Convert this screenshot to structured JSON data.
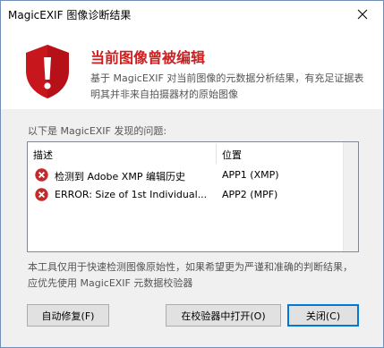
{
  "window": {
    "title": "MagicEXIF 图像诊断结果"
  },
  "header": {
    "headline": "当前图像曾被编辑",
    "description": "基于 MagicEXIF 对当前图像的元数据分析结果，有充足证据表明其并非来自拍摄器材的原始图像"
  },
  "issues": {
    "label": "以下是 MagicEXIF 发现的问题:",
    "columns": [
      "描述",
      "位置"
    ],
    "rows": [
      {
        "description": "检测到 Adobe XMP 编辑历史",
        "location": "APP1 (XMP)"
      },
      {
        "description": "ERROR: Size of 1st Individual...",
        "location": "APP2 (MPF)"
      }
    ]
  },
  "note": "本工具仅用于快速检测图像原始性，如果希望更为严谨和准确的判断结果，应优先使用 MagicEXIF 元数据校验器",
  "buttons": {
    "autofix": "自动修复(F)",
    "open_in_validator": "在校验器中打开(O)",
    "close": "关闭(C)"
  },
  "colors": {
    "headline": "#cc1f1f",
    "shield": "#c8161d",
    "error_icon": "#c42b2b",
    "default_button_border": "#0078d7"
  },
  "icons": {
    "shield": "shield-warning-icon",
    "error": "error-icon",
    "close": "close-icon"
  }
}
